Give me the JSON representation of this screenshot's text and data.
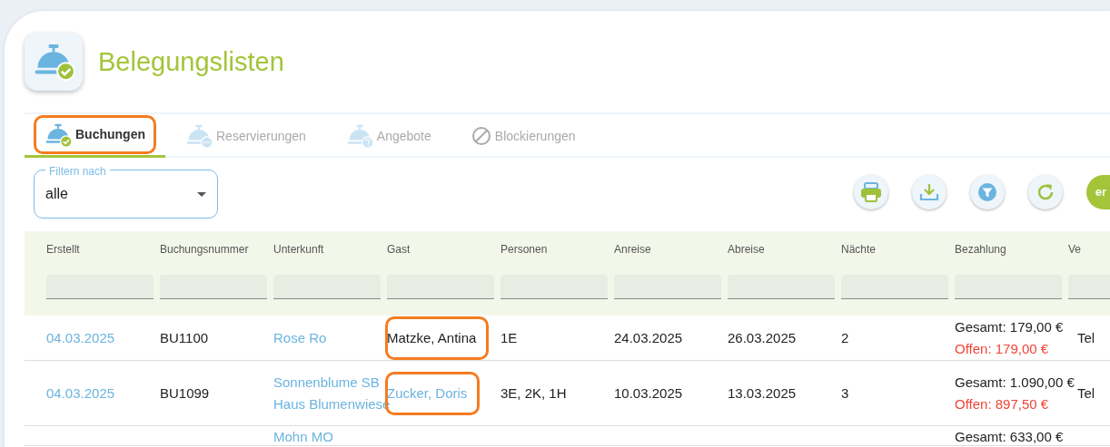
{
  "page": {
    "title": "Belegungslisten"
  },
  "tabs": [
    {
      "label": "Buchungen",
      "kind": "bookings",
      "selected": true,
      "annotated": true
    },
    {
      "label": "Reservierungen",
      "kind": "reservations",
      "selected": false,
      "annotated": false
    },
    {
      "label": "Angebote",
      "kind": "offers",
      "selected": false,
      "annotated": false
    },
    {
      "label": "Blockierungen",
      "kind": "blocked",
      "selected": false,
      "annotated": false
    }
  ],
  "filter": {
    "label": "Filtern nach",
    "value": "alle"
  },
  "toolbar": [
    {
      "kind": "print"
    },
    {
      "kind": "download"
    },
    {
      "kind": "filter"
    },
    {
      "kind": "refresh"
    },
    {
      "kind": "primary",
      "label": "er"
    }
  ],
  "table": {
    "columns": [
      "Erstellt",
      "Buchungsnummer",
      "Unterkunft",
      "Gast",
      "Personen",
      "Anreise",
      "Abreise",
      "Nächte",
      "Bezahlung",
      "Ve"
    ],
    "rows": [
      {
        "created": "04.03.2025",
        "number": "BU1100",
        "accommodation": [
          "Rose Ro"
        ],
        "guest": {
          "name": "Matzke, Antina",
          "link": false,
          "annotated": true
        },
        "persons": "1E",
        "arrival": "24.03.2025",
        "departure": "26.03.2025",
        "nights": "2",
        "total": "Gesamt: 179,00 €",
        "open": "Offen: 179,00 €",
        "column_10": "Tel"
      },
      {
        "created": "04.03.2025",
        "number": "BU1099",
        "accommodation": [
          "Sonnenblume SB",
          "Haus Blumenwiese"
        ],
        "guest": {
          "name": "Zucker, Doris",
          "link": true,
          "annotated": true
        },
        "persons": "3E, 2K, 1H",
        "arrival": "10.03.2025",
        "departure": "13.03.2025",
        "nights": "3",
        "total": "Gesamt: 1.090,00 €",
        "open": "Offen: 897,50 €",
        "column_10": "Tel"
      },
      {
        "accommodation": [
          "Mohn MO"
        ],
        "total": "Gesamt: 633,00 €"
      }
    ]
  }
}
